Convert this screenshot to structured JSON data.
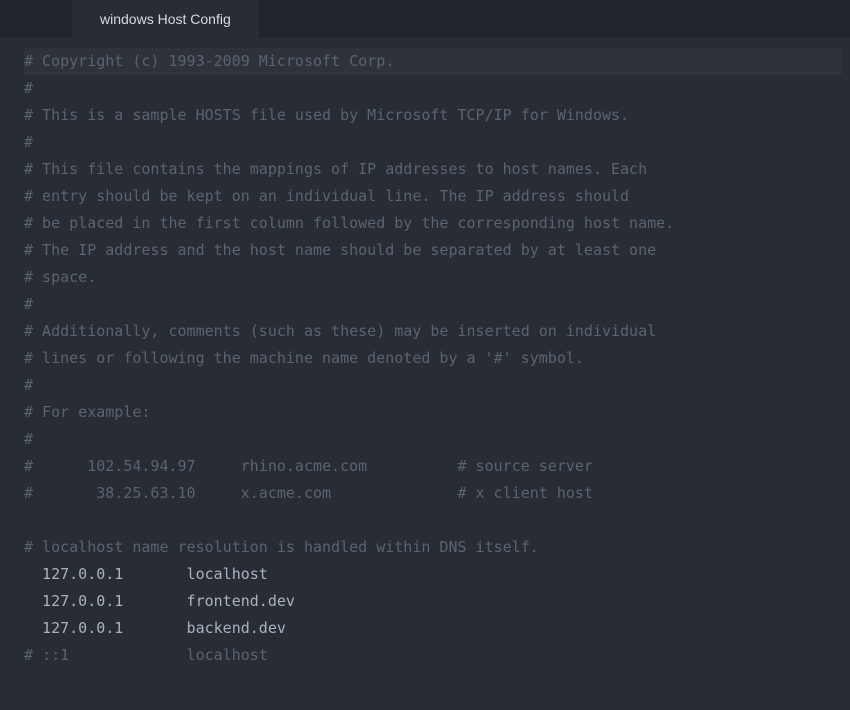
{
  "tab": {
    "title": "windows Host Config"
  },
  "lines": [
    "# Copyright (c) 1993-2009 Microsoft Corp.",
    "#",
    "# This is a sample HOSTS file used by Microsoft TCP/IP for Windows.",
    "#",
    "# This file contains the mappings of IP addresses to host names. Each",
    "# entry should be kept on an individual line. The IP address should",
    "# be placed in the first column followed by the corresponding host name.",
    "# The IP address and the host name should be separated by at least one",
    "# space.",
    "#",
    "# Additionally, comments (such as these) may be inserted on individual",
    "# lines or following the machine name denoted by a '#' symbol.",
    "#",
    "# For example:",
    "#",
    "#      102.54.94.97     rhino.acme.com          # source server",
    "#       38.25.63.10     x.acme.com              # x client host",
    "",
    "# localhost name resolution is handled within DNS itself.",
    "  127.0.0.1       localhost",
    "  127.0.0.1       frontend.dev",
    "  127.0.0.1       backend.dev",
    "# ::1             localhost"
  ],
  "entry_line_indexes": [
    19,
    20,
    21
  ],
  "highlight_line_index": 0,
  "colors": {
    "background": "#282c34",
    "tab_bar": "#21252b",
    "comment": "#5c6370",
    "text": "#abb2bf",
    "gutter": "#3e4451"
  }
}
